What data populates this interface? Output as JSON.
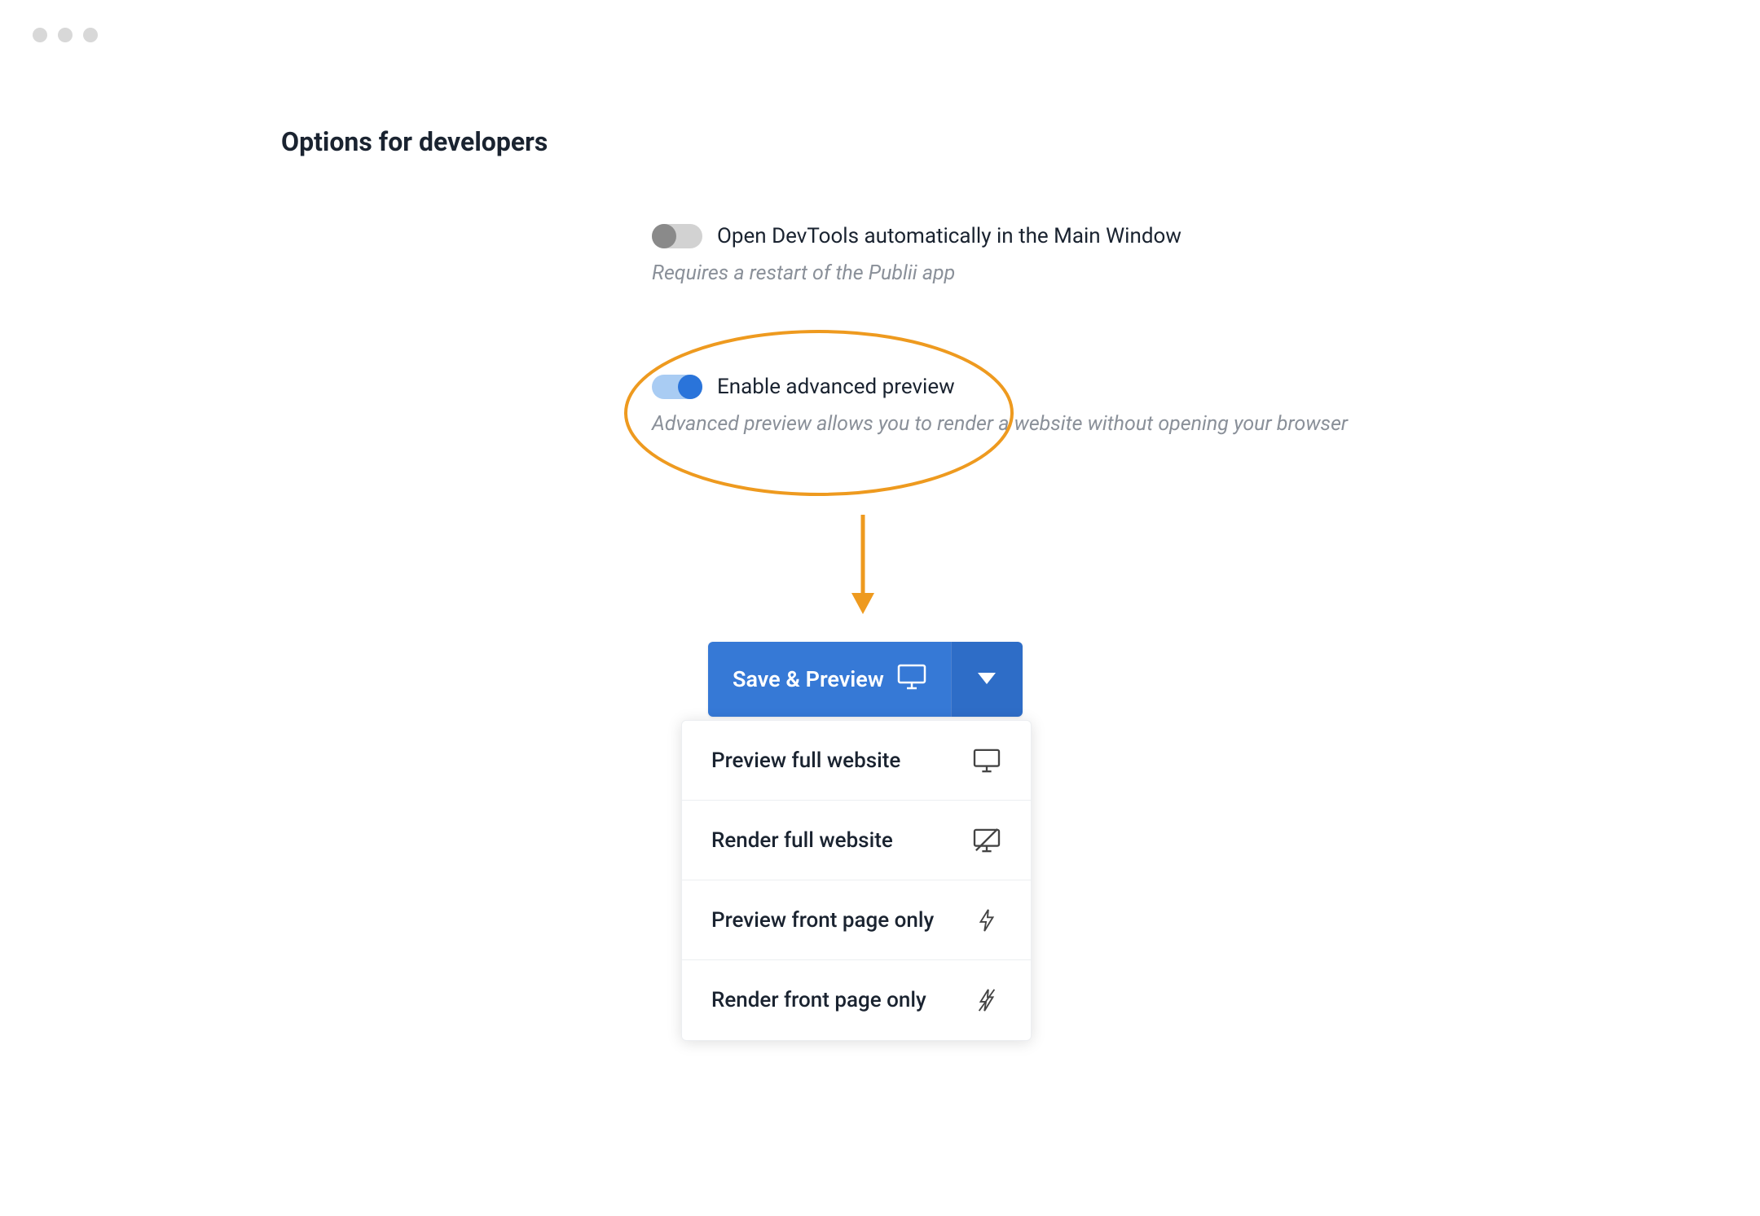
{
  "title": "Options for developers",
  "options": {
    "devtools": {
      "label": "Open DevTools automatically in the Main Window",
      "helper": "Requires a restart of the Publii app",
      "enabled": false
    },
    "advancedPreview": {
      "label": "Enable advanced preview",
      "helper": "Advanced preview allows you to render a website without opening your browser",
      "enabled": true
    }
  },
  "button": {
    "label": "Save & Preview"
  },
  "dropdown": {
    "items": [
      {
        "label": "Preview full website",
        "icon": "monitor-icon"
      },
      {
        "label": "Render full website",
        "icon": "monitor-off-icon"
      },
      {
        "label": "Preview front page only",
        "icon": "bolt-icon"
      },
      {
        "label": "Render front page only",
        "icon": "bolt-off-icon"
      }
    ]
  },
  "colors": {
    "accent": "#3679d6",
    "highlight": "#ee9a1f"
  }
}
